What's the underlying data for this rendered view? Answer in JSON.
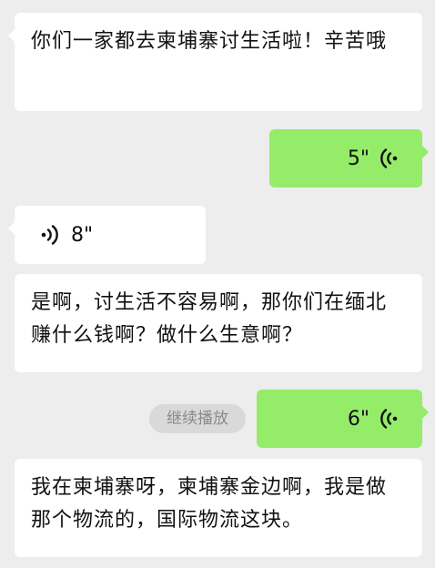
{
  "messages": [
    {
      "side": "left",
      "type": "text",
      "text": "你们一家都去柬埔寨讨生活啦！辛苦哦"
    },
    {
      "side": "right",
      "type": "voice",
      "duration": "5\""
    },
    {
      "side": "left",
      "type": "voice",
      "duration": "8\""
    },
    {
      "side": "left",
      "type": "text",
      "text": "是啊，讨生活不容易啊，那你们在缅北赚什么钱啊？做什么生意啊？"
    },
    {
      "side": "right",
      "type": "voice",
      "duration": "6\""
    },
    {
      "side": "left",
      "type": "text",
      "text": "我在柬埔寨呀，柬埔寨金边啊，我是做那个物流的，国际物流这块。"
    }
  ],
  "continue_play_label": "继续播放",
  "icons": {
    "voice_outgoing": "voice-wave-left-icon",
    "voice_incoming": "voice-wave-right-icon"
  },
  "colors": {
    "background": "#ededed",
    "bubble_incoming": "#ffffff",
    "bubble_outgoing": "#95ec69",
    "pill_background": "#d9d9d9",
    "pill_text": "#8a8a8a"
  }
}
